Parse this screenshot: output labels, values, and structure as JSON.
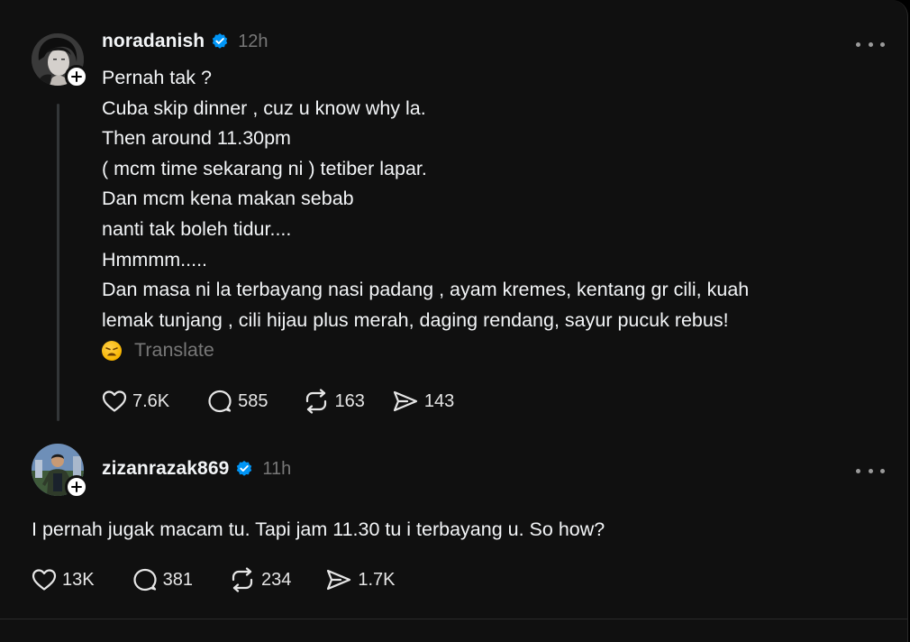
{
  "posts": [
    {
      "username": "noradanish",
      "time": "12h",
      "lines": [
        "Pernah tak ?",
        "Cuba skip dinner , cuz u know why la.",
        "Then around 11.30pm",
        "( mcm time sekarang ni ) tetiber lapar.",
        "Dan mcm kena makan sebab",
        "nanti tak boleh tidur....",
        "Hmmmm.....",
        "Dan masa ni la terbayang nasi padang , ayam kremes, kentang gr cili, kuah",
        "lemak tunjang , cili hijau plus merah, daging rendang, sayur pucuk rebus!"
      ],
      "translate_label": "Translate",
      "likes": "7.6K",
      "replies": "585",
      "reposts": "163",
      "shares": "143"
    },
    {
      "username": "zizanrazak869",
      "time": "11h",
      "lines": [
        "I pernah jugak macam tu. Tapi jam 11.30 tu i terbayang u. So how?"
      ],
      "likes": "13K",
      "replies": "381",
      "reposts": "234",
      "shares": "1.7K"
    }
  ],
  "colors": {
    "background": "#101010",
    "text": "#f3f5f7",
    "muted": "#777777",
    "verified": "#0095f6"
  }
}
